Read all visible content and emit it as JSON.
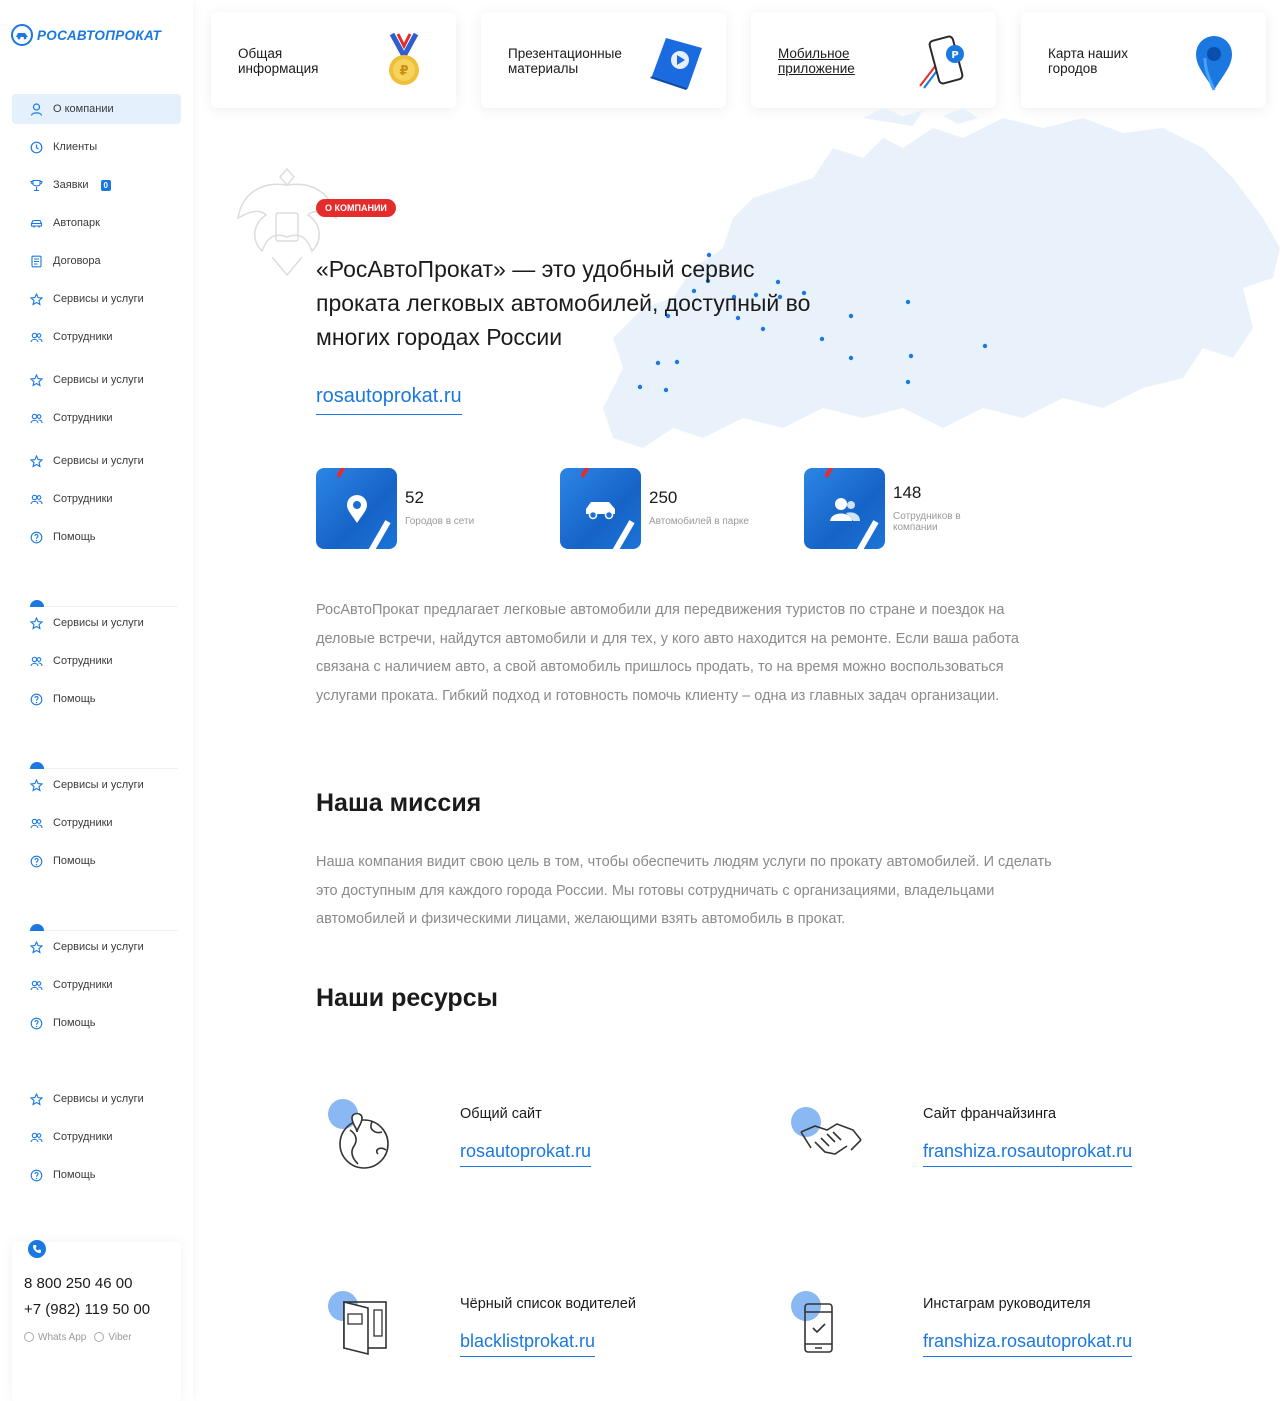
{
  "brand": {
    "name": "РОСАВТОПРОКАТ"
  },
  "sidebar": {
    "active": {
      "label": "О компании"
    },
    "items": [
      {
        "label": "Клиенты"
      },
      {
        "label": "Заявки",
        "badge": "0"
      },
      {
        "label": "Автопарк"
      },
      {
        "label": "Договора"
      },
      {
        "label": "Сервисы и услуги"
      },
      {
        "label": "Сотрудники"
      },
      {
        "label": "Сервисы и услуги"
      },
      {
        "label": "Сотрудники"
      },
      {
        "label": "Сервисы и услуги"
      },
      {
        "label": "Сотрудники"
      },
      {
        "label": "Помощь"
      },
      {
        "label": "Сервисы и услуги"
      },
      {
        "label": "Сотрудники"
      },
      {
        "label": "Помощь"
      },
      {
        "label": "Сервисы и услуги"
      },
      {
        "label": "Сотрудники"
      },
      {
        "label": "Помощь"
      },
      {
        "label": "Сервисы и услуги"
      },
      {
        "label": "Сотрудники"
      },
      {
        "label": "Помощь"
      },
      {
        "label": "Сервисы и услуги"
      },
      {
        "label": "Сотрудники"
      },
      {
        "label": "Помощь"
      }
    ],
    "contact": {
      "phone1": "8 800 250 46 00",
      "phone2": "+7 (982) 119 50 00",
      "whatsapp": "Whats App",
      "viber": "Viber"
    }
  },
  "cards": [
    {
      "label": "Общая информация"
    },
    {
      "label": "Презентационные материалы"
    },
    {
      "label": "Мобильное приложение"
    },
    {
      "label": "Карта наших городов"
    }
  ],
  "about": {
    "pill": "О КОМПАНИИ",
    "headline": "«РосАвтоПрокат» — это удобный сервис проката легковых автомобилей, доступный во многих городах России",
    "link": "rosautoprokat.ru"
  },
  "stats": [
    {
      "value": "52",
      "caption": "Городов в сети"
    },
    {
      "value": "250",
      "caption": "Автомобилей в парке"
    },
    {
      "value": "148",
      "caption": "Сотрудников в компании"
    }
  ],
  "intro": "РосАвтоПрокат предлагает легковые автомобили для передвижения туристов по стране и поездок на деловые встречи, найдутся автомобили и для тех, у кого авто находится на ремонте. Если ваша работа связана с наличием авто, а свой автомобиль пришлось продать, то на время можно воспользоваться услугами проката. Гибкий подход и готовность помочь клиенту – одна из главных задач организации.",
  "mission": {
    "title": "Наша миссия",
    "text": "Наша компания видит свою цель в том, чтобы обеспечить людям услуги по прокату автомобилей. И сделать это доступным для каждого города России. Мы готовы сотрудничать с организациями, владельцами автомобилей и физическими лицами, желающими взять автомобиль в прокат."
  },
  "resources": {
    "title": "Наши ресурсы",
    "items": [
      {
        "title": "Общий сайт",
        "link": "rosautoprokat.ru",
        "icon": "globe-icon"
      },
      {
        "title": "Сайт франчайзинга",
        "link": "franshiza.rosautoprokat.ru",
        "icon": "handshake-icon"
      },
      {
        "title": "Чёрный список водителей",
        "link": "blacklistprokat.ru",
        "icon": "door-icon"
      },
      {
        "title": "Инстаграм руководителя",
        "link": "franshiza.rosautoprokat.ru",
        "icon": "phone-icon"
      }
    ]
  },
  "colors": {
    "accent": "#1a78e0",
    "pill": "#e52c2c",
    "map": "#e9f2fb"
  }
}
